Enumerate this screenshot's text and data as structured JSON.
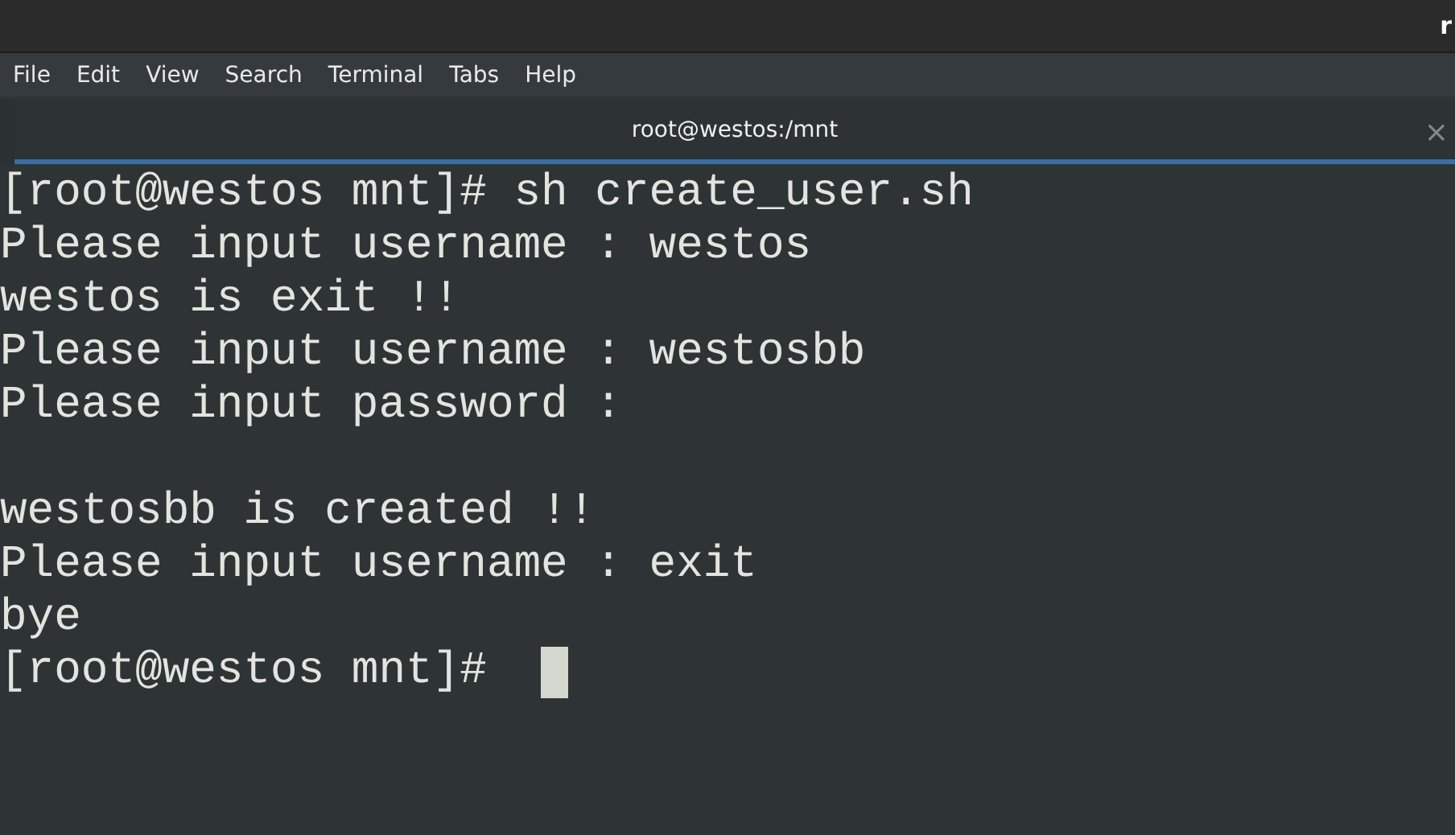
{
  "top_bar": {
    "title": "r"
  },
  "menu": [
    "File",
    "Edit",
    "View",
    "Search",
    "Terminal",
    "Tabs",
    "Help"
  ],
  "tab": {
    "title": "root@westos:/mnt",
    "close": "×",
    "selected": true
  },
  "terminal": {
    "lines": [
      {
        "kind": "text",
        "text": "[root@westos mnt]# sh create_user.sh"
      },
      {
        "kind": "text",
        "text": "Please input username : westos"
      },
      {
        "kind": "text",
        "text": "westos is exit !!"
      },
      {
        "kind": "text",
        "text": "Please input username : westosbb"
      },
      {
        "kind": "text",
        "text": "Please input password :"
      },
      {
        "kind": "blank"
      },
      {
        "kind": "text",
        "text": "westosbb is created !!"
      },
      {
        "kind": "text",
        "text": "Please input username : exit"
      },
      {
        "kind": "text",
        "text": "bye"
      },
      {
        "kind": "text",
        "text": "[root@westos mnt]#"
      }
    ],
    "cursor": true
  }
}
